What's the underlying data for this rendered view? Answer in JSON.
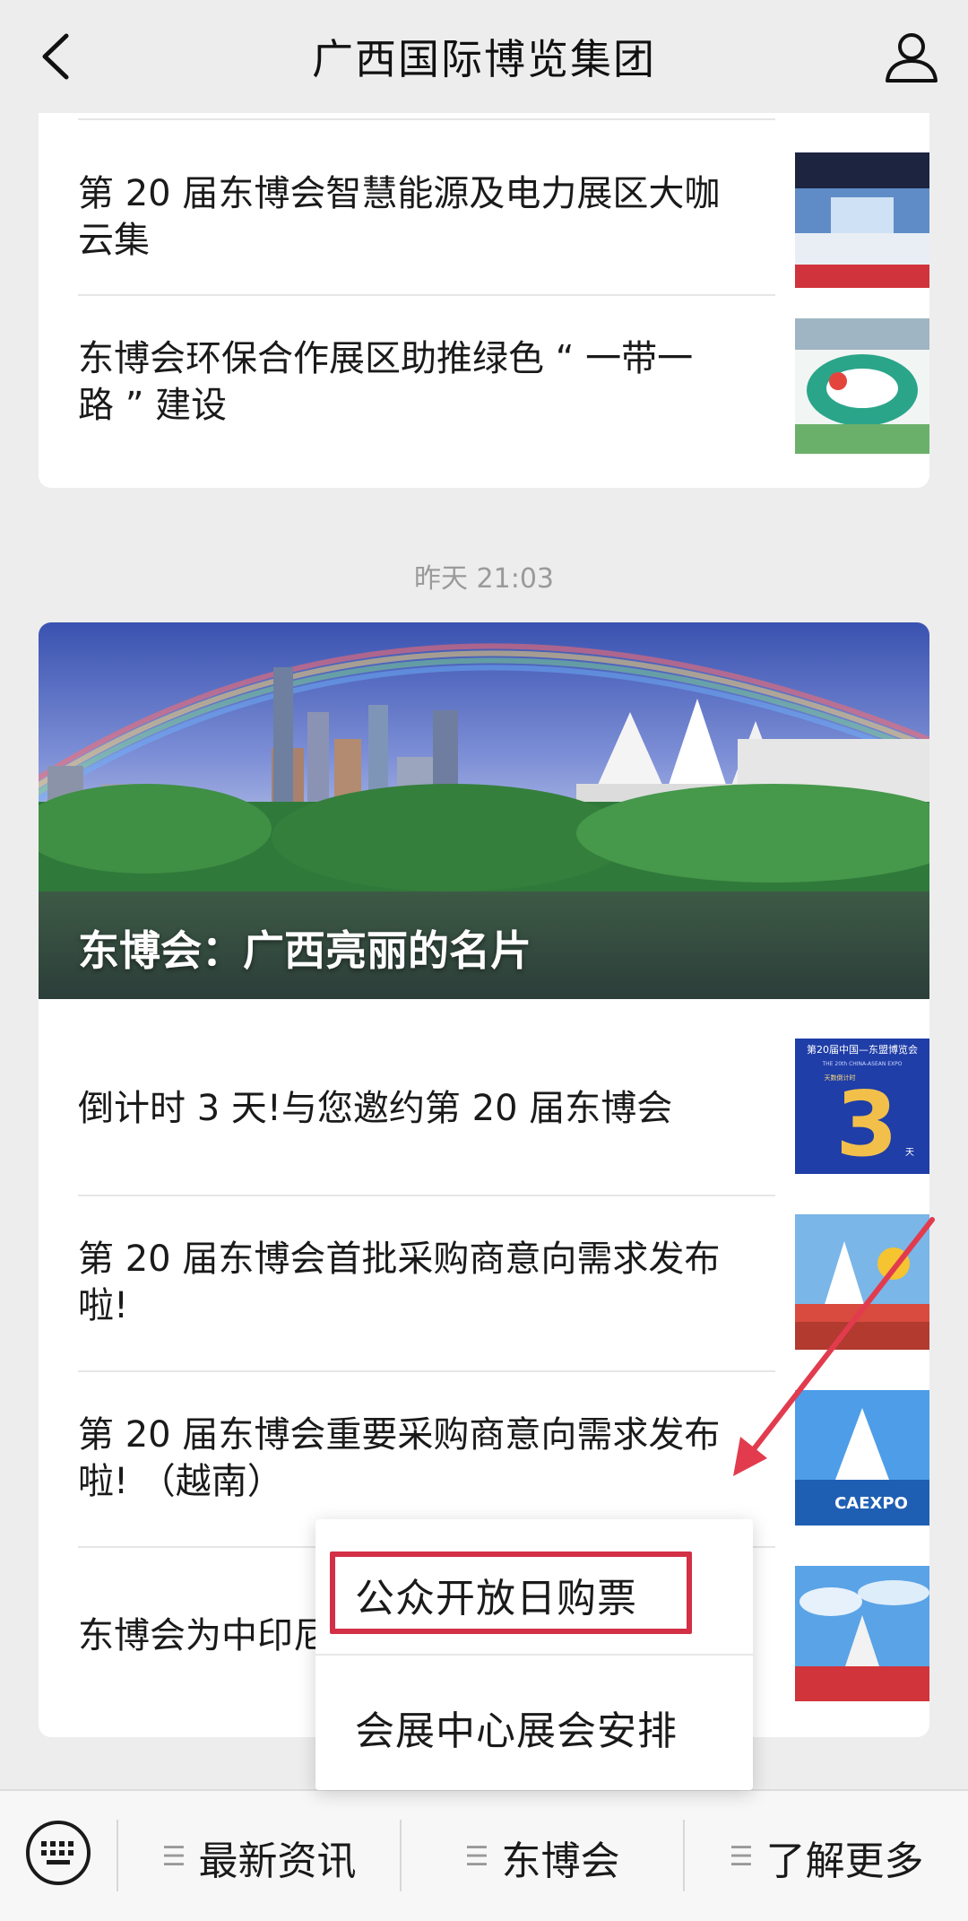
{
  "header": {
    "title": "广西国际博览集团"
  },
  "card1": {
    "items": [
      {
        "title": "第 20 届东博会智慧能源及电力展区大咖云集"
      },
      {
        "title": "东博会环保合作展区助推绿色 “ 一带一路 ” 建设"
      }
    ]
  },
  "time_label": "昨天 21:03",
  "card2": {
    "hero_caption": "东博会：广西亮丽的名片",
    "items": [
      {
        "title": "倒计时 3 天!与您邀约第 20 届东博会",
        "thumb_text": "第20届中国—东盟博览会",
        "thumb_subtext": "THE 20th CHINA-ASEAN EXPO",
        "thumb_number": "3",
        "thumb_countdown": "天数倒计时",
        "thumb_unit": "天"
      },
      {
        "title": "第 20 届东博会首批采购商意向需求发布啦!"
      },
      {
        "title": "第 20 届东博会重要采购商意向需求发布啦! （越南）",
        "thumb_text": "CAEXPO"
      },
      {
        "title": "东博会为中印尼"
      }
    ]
  },
  "popup": {
    "items": [
      {
        "label": "公众开放日购票"
      },
      {
        "label": "会展中心展会安排"
      }
    ]
  },
  "bottom_menu": {
    "items": [
      {
        "label": "最新资讯"
      },
      {
        "label": "东博会"
      },
      {
        "label": "了解更多"
      }
    ]
  },
  "colors": {
    "highlight": "#d32f47",
    "arrow": "#e23b4e"
  }
}
